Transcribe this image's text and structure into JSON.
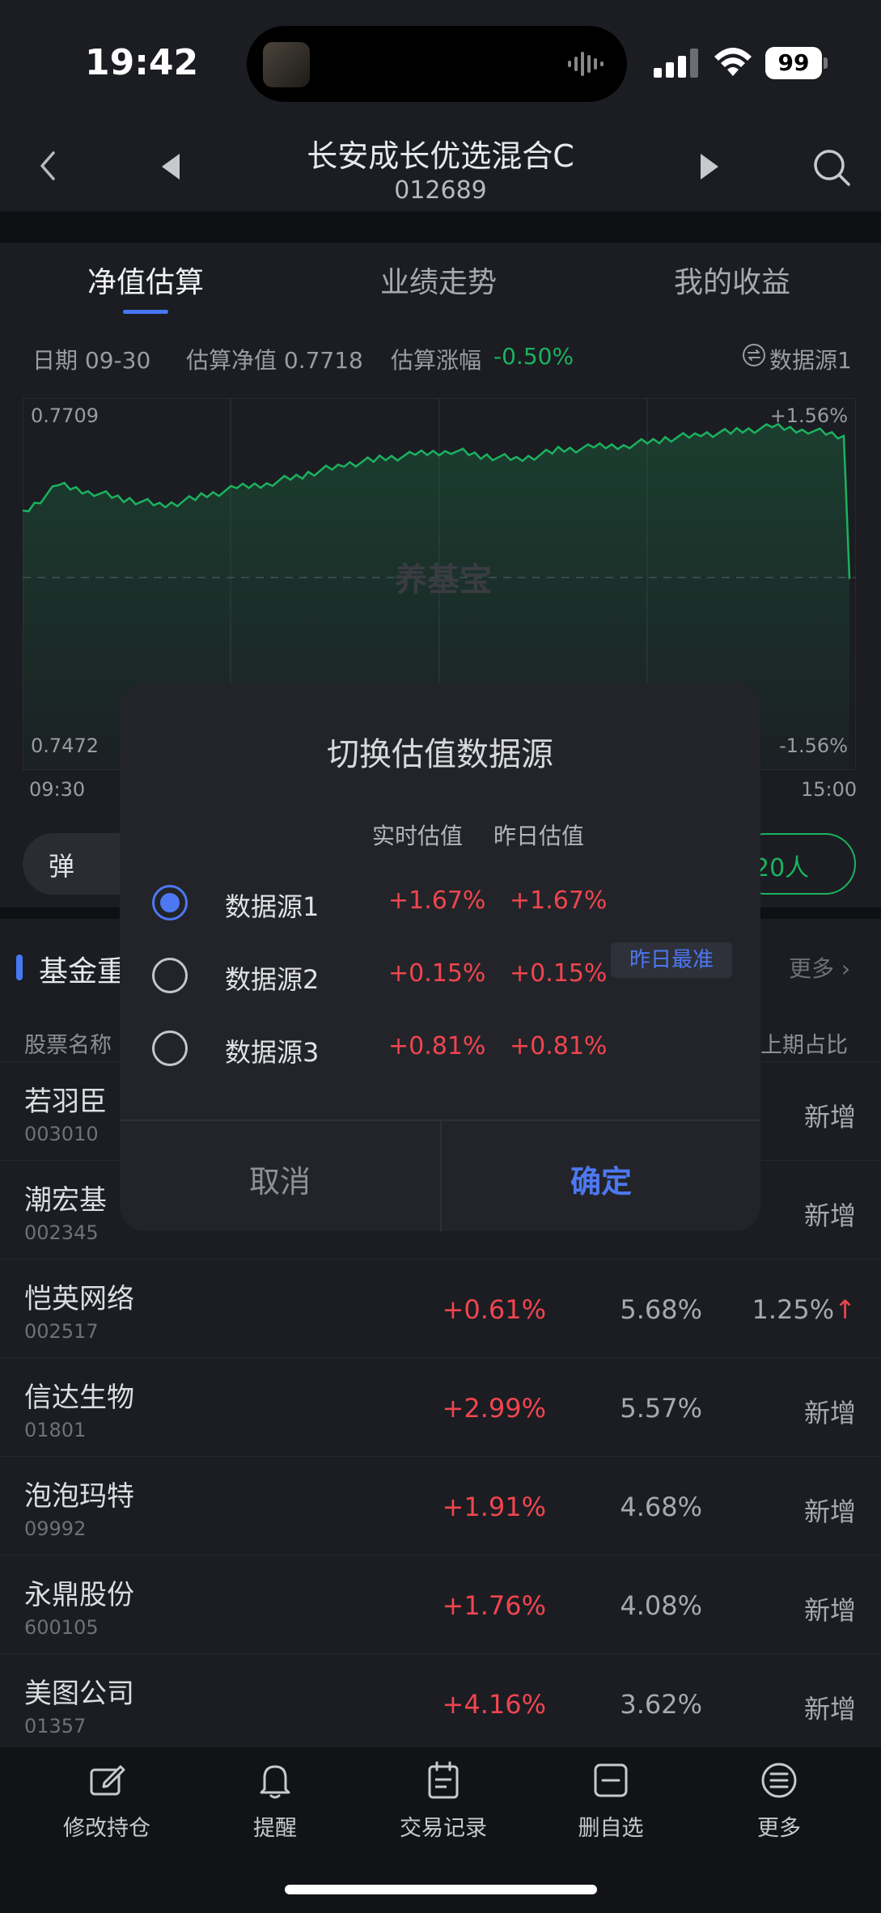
{
  "status": {
    "time": "19:42",
    "battery": "99"
  },
  "header": {
    "fund_name": "长安成长优选混合C",
    "fund_code": "012689"
  },
  "tabs": [
    {
      "label": "净值估算",
      "active": true
    },
    {
      "label": "业绩走势",
      "active": false
    },
    {
      "label": "我的收益",
      "active": false
    }
  ],
  "info": {
    "date": "日期 09-30",
    "nav_est": "估算净值 0.7718",
    "chg_label": "估算涨幅",
    "chg_value": "-0.50%",
    "data_source": "数据源1"
  },
  "chart": {
    "y_top": "0.7709",
    "y_bottom": "0.7472",
    "pct_top": "+1.56%",
    "pct_bottom": "-1.56%",
    "x_start": "09:30",
    "x_end": "15:00",
    "watermark": "养基宝"
  },
  "chart_data": {
    "type": "line",
    "title": "",
    "x": [
      "09:30",
      "15:00"
    ],
    "y_range": [
      0.7472,
      0.7709
    ],
    "pct_range": [
      "-1.56%",
      "+1.56%"
    ],
    "series": [
      {
        "values": [
          0.764,
          0.766,
          0.7655,
          0.765,
          0.7646,
          0.7652,
          0.7658,
          0.7662,
          0.7668,
          0.7674,
          0.7678,
          0.7681,
          0.7684,
          0.768,
          0.7678,
          0.7684,
          0.7686,
          0.7688,
          0.7692,
          0.7695,
          0.7697,
          0.77,
          0.7698,
          0.7694
        ]
      }
    ],
    "colors": {
      "line": "#1bb25f"
    }
  },
  "below_chart": {
    "danmu": "弹",
    "people": "20人"
  },
  "holdings": {
    "title": "基金重",
    "more": "更多",
    "col_name": "股票名称",
    "col_prev": "上期占比",
    "rows": [
      {
        "name": "若羽臣",
        "code": "003010",
        "chg": "",
        "pct": "",
        "prev": "新增"
      },
      {
        "name": "潮宏基",
        "code": "002345",
        "chg": "",
        "pct": "",
        "prev": "新增"
      },
      {
        "name": "恺英网络",
        "code": "002517",
        "chg": "+0.61%",
        "pct": "5.68%",
        "prev": "1.25%↑"
      },
      {
        "name": "信达生物",
        "code": "01801",
        "chg": "+2.99%",
        "pct": "5.57%",
        "prev": "新增"
      },
      {
        "name": "泡泡玛特",
        "code": "09992",
        "chg": "+1.91%",
        "pct": "4.68%",
        "prev": "新增"
      },
      {
        "name": "永鼎股份",
        "code": "600105",
        "chg": "+1.76%",
        "pct": "4.08%",
        "prev": "新增"
      },
      {
        "name": "美图公司",
        "code": "01357",
        "chg": "+4.16%",
        "pct": "3.62%",
        "prev": "新增"
      }
    ]
  },
  "dialog": {
    "title": "切换估值数据源",
    "col_realtime": "实时估值",
    "col_yesterday": "昨日估值",
    "sources": [
      {
        "label": "数据源1",
        "realtime": "+1.67%",
        "yesterday": "+1.67%",
        "checked": true,
        "tag": ""
      },
      {
        "label": "数据源2",
        "realtime": "+0.15%",
        "yesterday": "+0.15%",
        "checked": false,
        "tag": "昨日最准"
      },
      {
        "label": "数据源3",
        "realtime": "+0.81%",
        "yesterday": "+0.81%",
        "checked": false,
        "tag": ""
      }
    ],
    "cancel": "取消",
    "confirm": "确定"
  },
  "bottom_nav": [
    {
      "label": "修改持仓",
      "icon": "edit-holdings-icon"
    },
    {
      "label": "提醒",
      "icon": "bell-icon"
    },
    {
      "label": "交易记录",
      "icon": "calendar-icon"
    },
    {
      "label": "删自选",
      "icon": "remove-watchlist-icon"
    },
    {
      "label": "更多",
      "icon": "menu-icon"
    }
  ]
}
